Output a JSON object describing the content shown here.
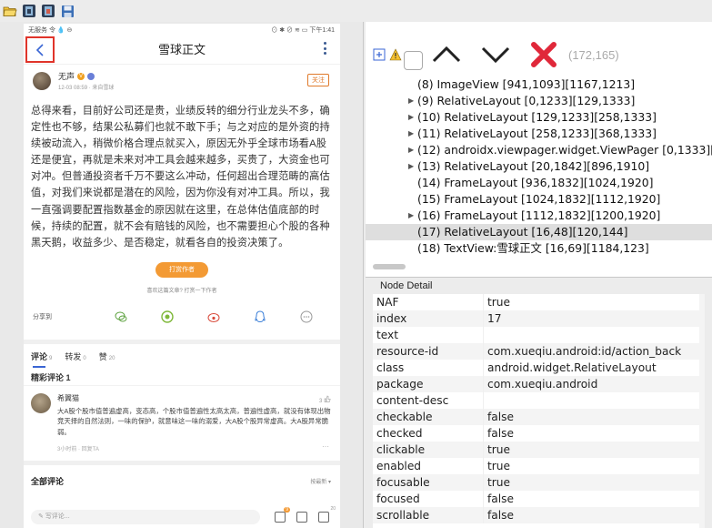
{
  "toolbar": {
    "icons": [
      "open-folder-icon",
      "device-screenshot-icon",
      "device-screenshot-compressed-icon",
      "save-icon"
    ]
  },
  "phone": {
    "status_left": "无服务 令 💧 ⊖",
    "status_right": "⊙ ✱ ⊘ ≋ ▭ 下午1:41",
    "title": "雪球正文",
    "author": {
      "name": "无声",
      "time": "12-03 08:59 · 来自雪球",
      "follow": "关注"
    },
    "article": "总得来看，目前好公司还是贵，业绩反转的细分行业龙头不多，确定性也不够，结果公私募们也就不敢下手；与之对应的是外资的持续被动流入，稍微价格合理点就买入，原因无外乎全球市场看A股还是便宜，再就是未来对冲工具会越来越多，买贵了，大资金也可对冲。但普通投资者千万不要这么冲动，任何超出合理范畴的高估值，对我们来说都是潜在的风险，因为你没有对冲工具。所以，我一直强调要配置指数基金的原因就在这里，在总体估值底部的时候，持续的配置，就不会有赔钱的风险，也不需要担心个股的各种黑天鹅，收益多少、是否稳定，就看各自的投资决策了。",
    "tip_button": "打赏作者",
    "tip_sub": "喜欢这篇文章? 打赏一下作者",
    "share_label": "分享到",
    "tabs": [
      {
        "label": "评论",
        "count": "9"
      },
      {
        "label": "转发",
        "count": "0"
      },
      {
        "label": "赞",
        "count": "20"
      }
    ],
    "featured_title": "精彩评论 1",
    "comment": {
      "name": "希翼猫",
      "likes": "3",
      "text": "大A股个股市值普遍虚高，变态高，个股市值普遍性太高太高，普遍性虚高，就没有体现出物竞天择的自然法则，一味的保护，就意味这一味的溺爱，大A股个股异常虚高。大A股异常脆弱。",
      "meta": "3小时前 · 回复TA",
      "dots": "···"
    },
    "all_comments": "全部评论",
    "sort": "按最新 ▾",
    "input_placeholder": "写评论...",
    "badge_count_a": "9",
    "badge_count_b": "20"
  },
  "tree_toolbar": {
    "coord": "(172,165)"
  },
  "tree": [
    {
      "text": "(8) ImageView [941,1093][1167,1213]",
      "expandable": false,
      "selected": false
    },
    {
      "text": "(9) RelativeLayout [0,1233][129,1333]",
      "expandable": true,
      "selected": false
    },
    {
      "text": "(10) RelativeLayout [129,1233][258,1333]",
      "expandable": true,
      "selected": false
    },
    {
      "text": "(11) RelativeLayout [258,1233][368,1333]",
      "expandable": true,
      "selected": false
    },
    {
      "text": "(12) androidx.viewpager.widget.ViewPager [0,1333][",
      "expandable": true,
      "selected": false
    },
    {
      "text": "(13) RelativeLayout [20,1842][896,1910]",
      "expandable": true,
      "selected": false
    },
    {
      "text": "(14) FrameLayout [936,1832][1024,1920]",
      "expandable": false,
      "selected": false
    },
    {
      "text": "(15) FrameLayout [1024,1832][1112,1920]",
      "expandable": false,
      "selected": false
    },
    {
      "text": "(16) FrameLayout [1112,1832][1200,1920]",
      "expandable": true,
      "selected": false
    },
    {
      "text": "(17) RelativeLayout [16,48][120,144]",
      "expandable": false,
      "selected": true
    },
    {
      "text": "(18) TextView:雪球正文 [16,69][1184,123]",
      "expandable": false,
      "selected": false
    }
  ],
  "node_detail": {
    "title": "Node Detail",
    "rows": [
      {
        "key": "NAF",
        "value": "true"
      },
      {
        "key": "index",
        "value": "17"
      },
      {
        "key": "text",
        "value": ""
      },
      {
        "key": "resource-id",
        "value": "com.xueqiu.android:id/action_back"
      },
      {
        "key": "class",
        "value": "android.widget.RelativeLayout"
      },
      {
        "key": "package",
        "value": "com.xueqiu.android"
      },
      {
        "key": "content-desc",
        "value": ""
      },
      {
        "key": "checkable",
        "value": "false"
      },
      {
        "key": "checked",
        "value": "false"
      },
      {
        "key": "clickable",
        "value": "true"
      },
      {
        "key": "enabled",
        "value": "true"
      },
      {
        "key": "focusable",
        "value": "true"
      },
      {
        "key": "focused",
        "value": "false"
      },
      {
        "key": "scrollable",
        "value": "false"
      }
    ]
  },
  "colors": {
    "highlight_red": "#e0342a",
    "accent_orange": "#f39a34",
    "delete_red": "#e0283a"
  }
}
